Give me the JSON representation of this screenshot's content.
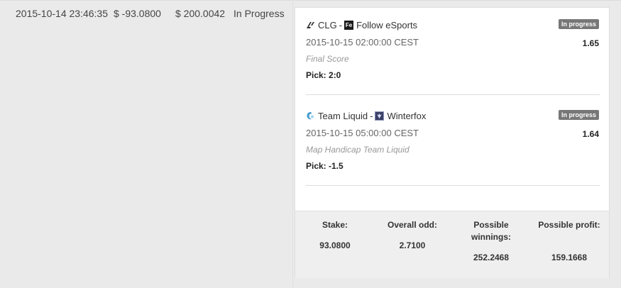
{
  "history_row": {
    "date": "2015-10-14 23:46:35",
    "stake": "$ -93.0800",
    "winnings": "$ 200.0042",
    "status": "In Progress"
  },
  "bets": [
    {
      "team1": "CLG",
      "team1_icon": "clg-logo-icon",
      "team2": "Follow eSports",
      "team2_icon": "fe-logo-icon",
      "separator": "-",
      "datetime": "2015-10-15 02:00:00 CEST",
      "market": "Final Score",
      "pick": "Pick: 2:0",
      "status_badge": "In progress",
      "odd": "1.65"
    },
    {
      "team1": "Team Liquid",
      "team1_icon": "team-liquid-logo-icon",
      "team2": "Winterfox",
      "team2_icon": "winterfox-logo-icon",
      "separator": "-",
      "datetime": "2015-10-15 05:00:00 CEST",
      "market": "Map Handicap Team Liquid",
      "pick": "Pick: -1.5",
      "status_badge": "In progress",
      "odd": "1.64"
    }
  ],
  "summary": {
    "stake_label": "Stake:",
    "stake_value": "93.0800",
    "odd_label": "Overall odd:",
    "odd_value": "2.7100",
    "winnings_label": "Possible winnings:",
    "winnings_value": "252.2468",
    "profit_label": "Possible profit:",
    "profit_value": "159.1668"
  },
  "colors": {
    "badge": "#777777",
    "page_bg": "#eaeaea",
    "summary_bg": "#efefef"
  }
}
